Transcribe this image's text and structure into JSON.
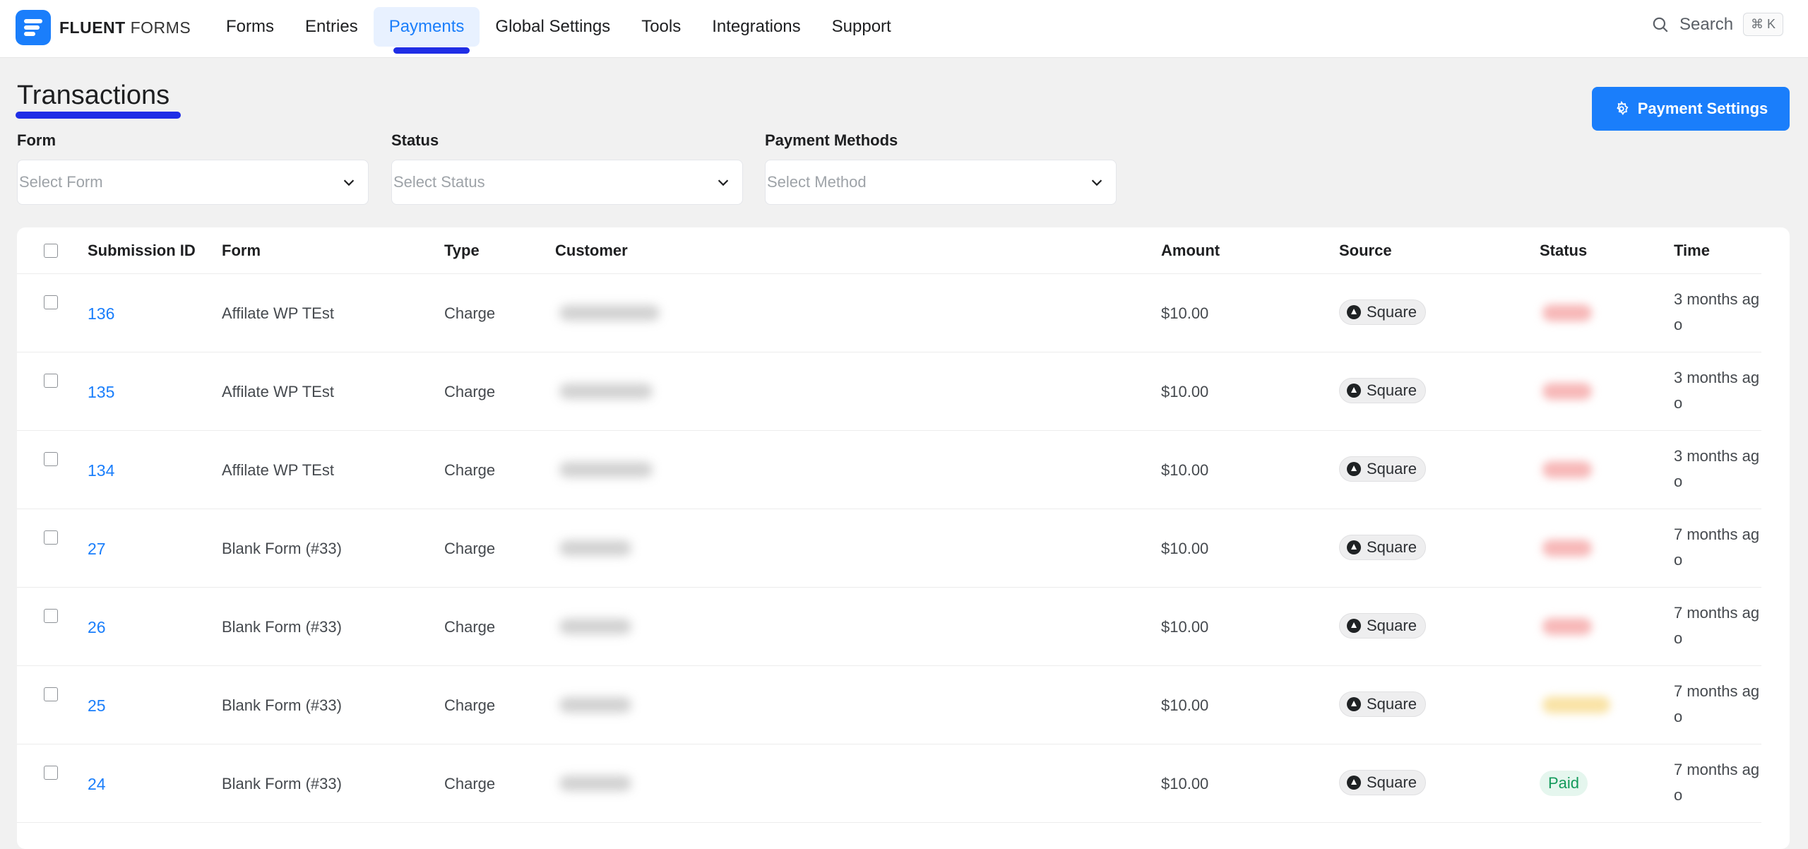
{
  "app": {
    "brand_bold": "FLUENT",
    "brand_light": "FORMS"
  },
  "nav": {
    "items": [
      {
        "label": "Forms"
      },
      {
        "label": "Entries"
      },
      {
        "label": "Payments",
        "active": true
      },
      {
        "label": "Global Settings"
      },
      {
        "label": "Tools"
      },
      {
        "label": "Integrations"
      },
      {
        "label": "Support"
      }
    ],
    "search_label": "Search",
    "search_shortcut": "⌘ K"
  },
  "page": {
    "title": "Transactions",
    "settings_button": "Payment Settings"
  },
  "filters": {
    "form": {
      "label": "Form",
      "placeholder": "Select Form"
    },
    "status": {
      "label": "Status",
      "placeholder": "Select Status"
    },
    "methods": {
      "label": "Payment Methods",
      "placeholder": "Select Method"
    }
  },
  "table": {
    "headers": {
      "submission_id": "Submission ID",
      "form": "Form",
      "type": "Type",
      "customer": "Customer",
      "amount": "Amount",
      "source": "Source",
      "status": "Status",
      "time": "Time"
    },
    "rows": [
      {
        "id": "136",
        "form": "Affilate WP TEst",
        "type": "Charge",
        "amount": "$10.00",
        "source": "Square",
        "status": "",
        "status_tone": "failed",
        "time": "3 months ago"
      },
      {
        "id": "135",
        "form": "Affilate WP TEst",
        "type": "Charge",
        "amount": "$10.00",
        "source": "Square",
        "status": "",
        "status_tone": "failed",
        "time": "3 months ago"
      },
      {
        "id": "134",
        "form": "Affilate WP TEst",
        "type": "Charge",
        "amount": "$10.00",
        "source": "Square",
        "status": "",
        "status_tone": "failed",
        "time": "3 months ago"
      },
      {
        "id": "27",
        "form": "Blank Form (#33)",
        "type": "Charge",
        "amount": "$10.00",
        "source": "Square",
        "status": "",
        "status_tone": "failed",
        "time": "7 months ago"
      },
      {
        "id": "26",
        "form": "Blank Form (#33)",
        "type": "Charge",
        "amount": "$10.00",
        "source": "Square",
        "status": "",
        "status_tone": "failed",
        "time": "7 months ago"
      },
      {
        "id": "25",
        "form": "Blank Form (#33)",
        "type": "Charge",
        "amount": "$10.00",
        "source": "Square",
        "status": "",
        "status_tone": "pending",
        "time": "7 months ago"
      },
      {
        "id": "24",
        "form": "Blank Form (#33)",
        "type": "Charge",
        "amount": "$10.00",
        "source": "Square",
        "status": "Paid",
        "status_tone": "paid",
        "time": "7 months ago"
      }
    ]
  },
  "colors": {
    "accent": "#1a7efb",
    "annotation": "#1f2ee6",
    "failed": "#f7b8b8",
    "pending": "#f9e3a6",
    "paid_bg": "#e5f6ee",
    "paid_text": "#139a5b"
  }
}
